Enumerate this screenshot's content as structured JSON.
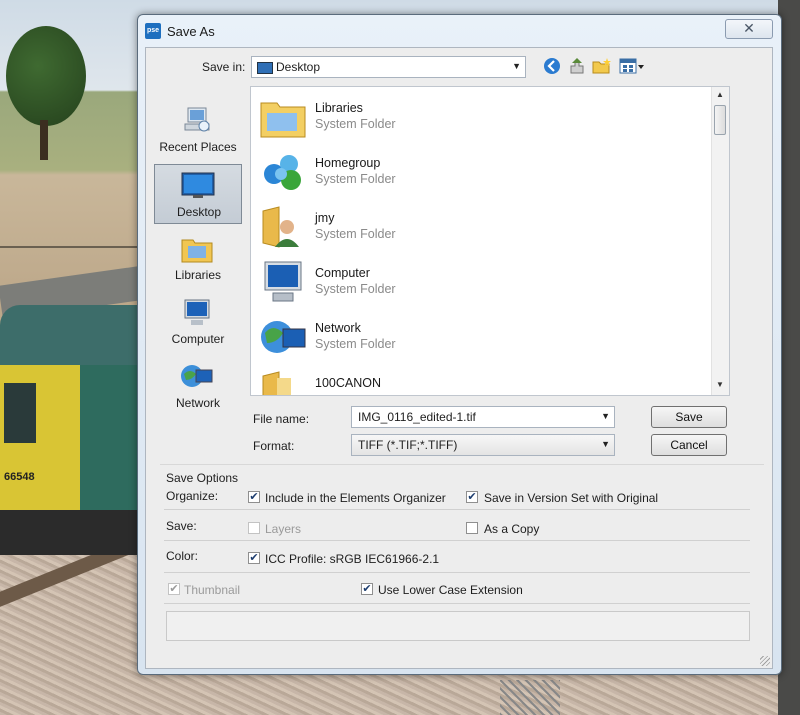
{
  "window": {
    "title": "Save As",
    "close_glyph": "✕",
    "app_icon_text": "pse"
  },
  "save_in": {
    "label": "Save in:",
    "value": "Desktop"
  },
  "places": [
    {
      "label": "Recent Places",
      "icon": "recent-places-icon"
    },
    {
      "label": "Desktop",
      "icon": "desktop-icon",
      "selected": true
    },
    {
      "label": "Libraries",
      "icon": "libraries-icon"
    },
    {
      "label": "Computer",
      "icon": "computer-icon"
    },
    {
      "label": "Network",
      "icon": "network-icon"
    }
  ],
  "files": [
    {
      "name": "Libraries",
      "type": "System Folder",
      "icon": "libraries-folder-icon"
    },
    {
      "name": "Homegroup",
      "type": "System Folder",
      "icon": "homegroup-icon"
    },
    {
      "name": "jmy",
      "type": "System Folder",
      "icon": "user-folder-icon"
    },
    {
      "name": "Computer",
      "type": "System Folder",
      "icon": "computer-icon"
    },
    {
      "name": "Network",
      "type": "System Folder",
      "icon": "network-icon"
    },
    {
      "name": "100CANON",
      "type": "",
      "icon": "folder-icon"
    }
  ],
  "filename": {
    "label": "File name:",
    "value": "IMG_0116_edited-1.tif"
  },
  "format": {
    "label": "Format:",
    "value": "TIFF (*.TIF;*.TIFF)"
  },
  "buttons": {
    "save": "Save",
    "cancel": "Cancel"
  },
  "options": {
    "heading": "Save Options",
    "organize_label": "Organize:",
    "include_organizer": {
      "label": "Include in the Elements Organizer",
      "checked": true
    },
    "version_set": {
      "label": "Save in Version Set with Original",
      "checked": true
    },
    "save_label": "Save:",
    "layers": {
      "label": "Layers",
      "checked": false,
      "disabled": true
    },
    "as_copy": {
      "label": "As a Copy",
      "checked": false
    },
    "color_label": "Color:",
    "icc": {
      "label": "ICC Profile:  sRGB IEC61966-2.1",
      "checked": true
    },
    "thumbnail": {
      "label": "Thumbnail",
      "checked": true,
      "disabled": true
    },
    "lower_case": {
      "label": "Use Lower Case Extension",
      "checked": true
    }
  },
  "background": {
    "locomotive_number": "66548"
  }
}
